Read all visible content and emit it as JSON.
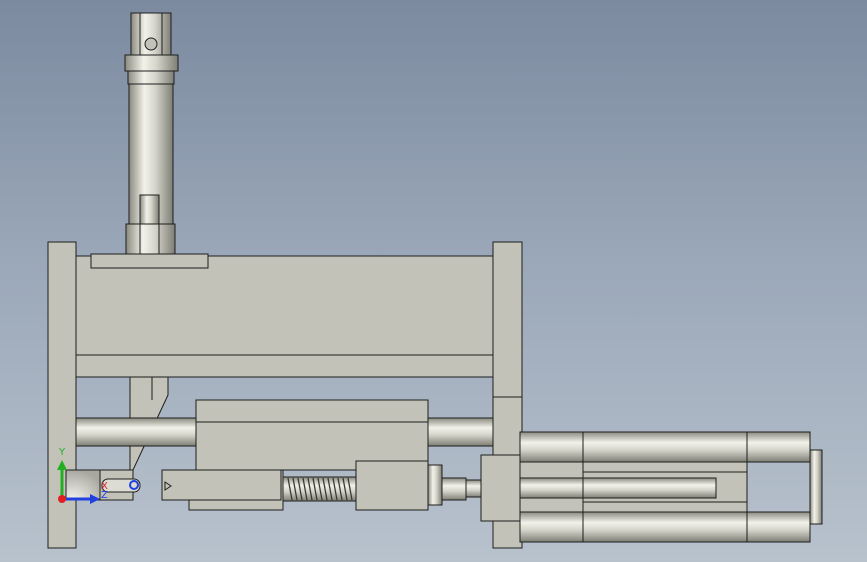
{
  "viewport": {
    "background_top": "#7c8aa0",
    "background_bottom": "#b8c2cd",
    "part_fill": "#c2c2b8",
    "part_stroke": "#1e1e1e",
    "metal_light": "#f2f2ea",
    "metal_dark": "#7e7e74"
  },
  "triad": {
    "x_axis_color": "#e02020",
    "y_axis_color": "#22b022",
    "z_axis_color": "#2040e0",
    "label_y": "Y",
    "label_z": "Z",
    "label_x": "X"
  }
}
